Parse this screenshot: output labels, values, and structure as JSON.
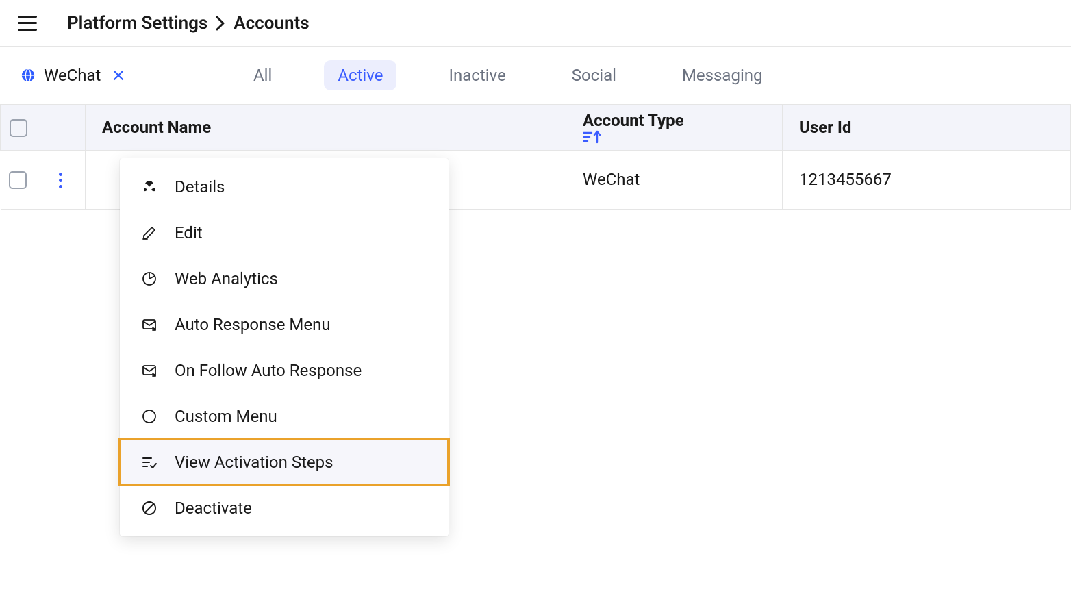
{
  "breadcrumb": {
    "parent": "Platform Settings",
    "current": "Accounts"
  },
  "chip": {
    "label": "WeChat"
  },
  "tabs": {
    "items": [
      {
        "label": "All",
        "active": false
      },
      {
        "label": "Active",
        "active": true
      },
      {
        "label": "Inactive",
        "active": false
      },
      {
        "label": "Social",
        "active": false
      },
      {
        "label": "Messaging",
        "active": false
      }
    ]
  },
  "table": {
    "headers": {
      "name": "Account Name",
      "type": "Account Type",
      "userid": "User Id"
    },
    "rows": [
      {
        "name": "",
        "type": "WeChat",
        "userid": "1213455667"
      }
    ]
  },
  "menu": {
    "items": [
      {
        "icon": "details-icon",
        "label": "Details"
      },
      {
        "icon": "edit-icon",
        "label": "Edit"
      },
      {
        "icon": "analytics-icon",
        "label": "Web Analytics"
      },
      {
        "icon": "auto-response-icon",
        "label": "Auto Response Menu"
      },
      {
        "icon": "follow-response-icon",
        "label": "On Follow Auto Response"
      },
      {
        "icon": "custom-menu-icon",
        "label": "Custom Menu"
      },
      {
        "icon": "steps-icon",
        "label": "View Activation Steps"
      },
      {
        "icon": "deactivate-icon",
        "label": "Deactivate"
      }
    ],
    "highlight_index": 6
  }
}
